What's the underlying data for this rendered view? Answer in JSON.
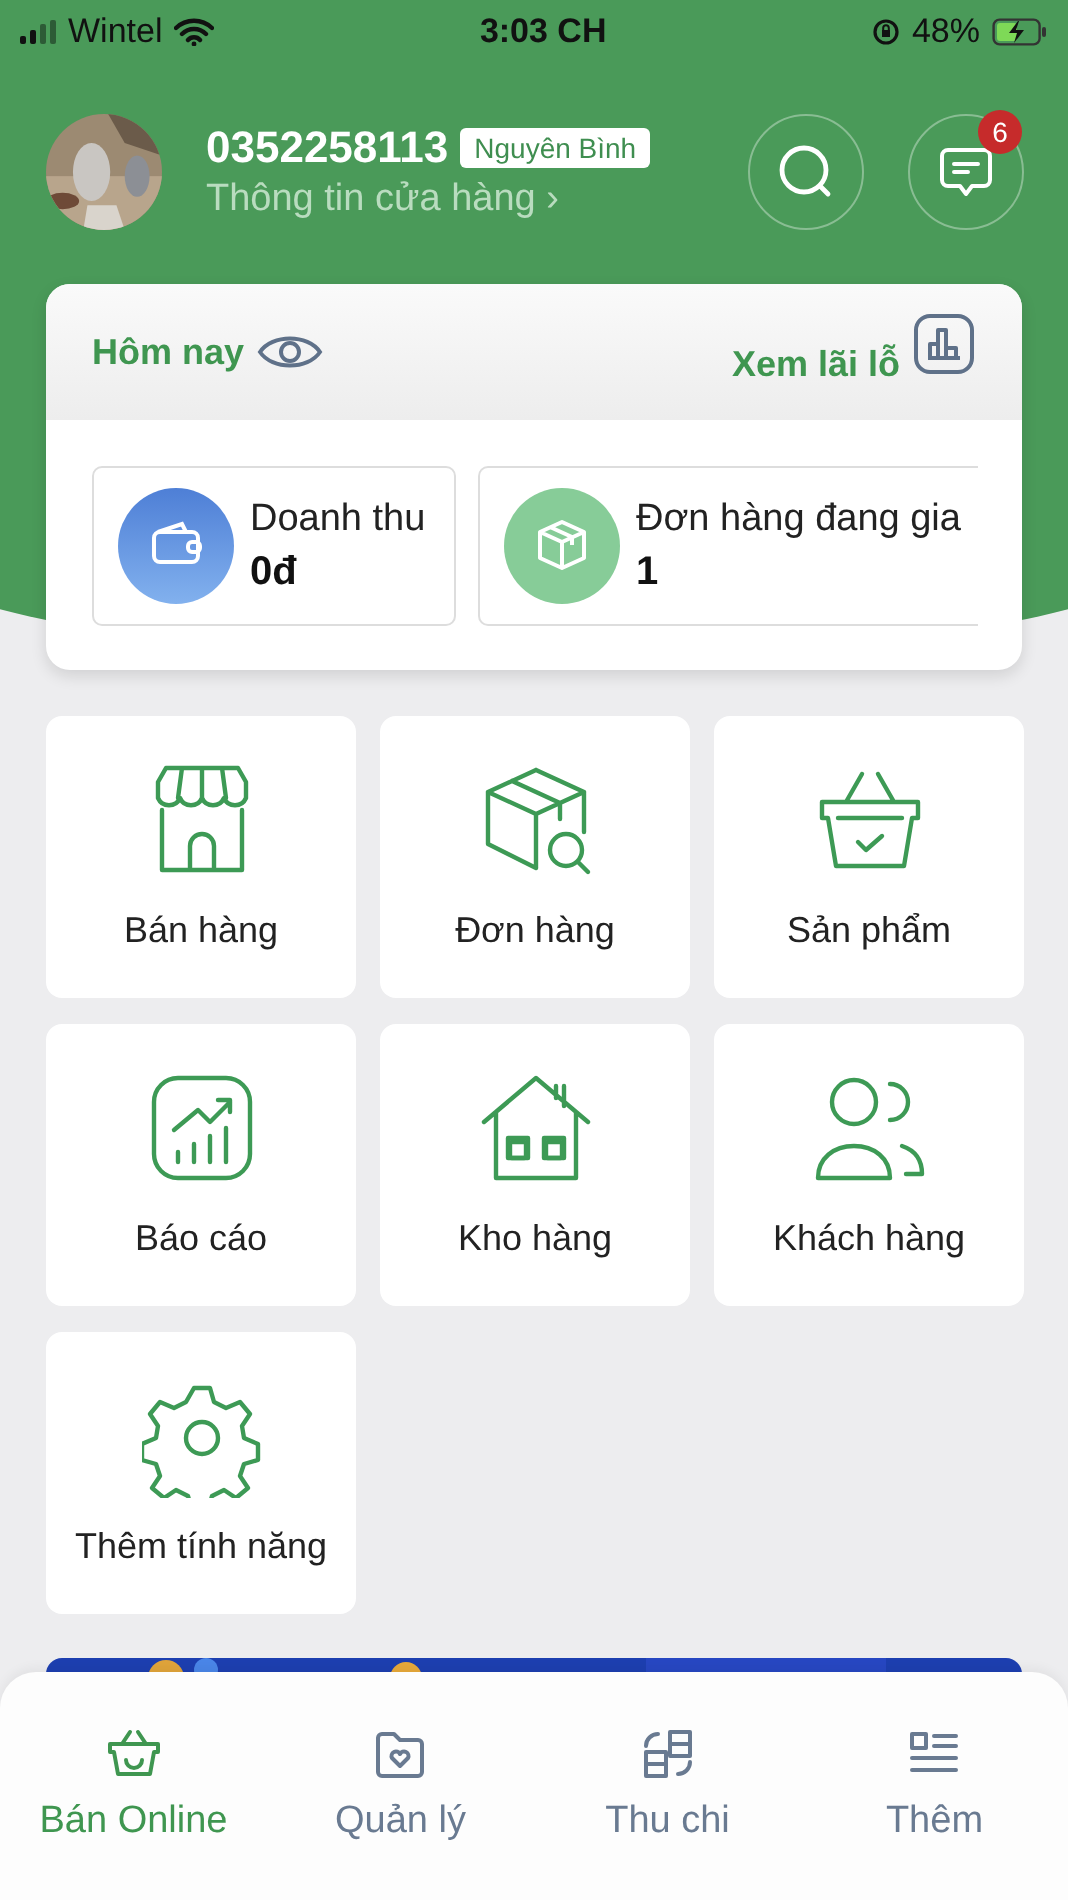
{
  "status_bar": {
    "carrier": "Wintel",
    "time": "3:03 CH",
    "battery": "48%"
  },
  "profile": {
    "kind": "picture",
    "phone": "0352258113",
    "name_badge": "Nguyên Bình",
    "store_link": "Thông tin cửa hàng",
    "store_chevron": "›",
    "notifications": "6"
  },
  "summary": {
    "title": "Hôm nay",
    "profit_link": "Xem lãi lỗ",
    "stats": [
      {
        "kind": "wallet",
        "label": "Doanh thu",
        "value": "0đ"
      },
      {
        "kind": "box",
        "label": "Đơn hàng đang gia",
        "value": "1"
      }
    ]
  },
  "features": [
    {
      "kind": "store",
      "label": "Bán hàng"
    },
    {
      "kind": "order",
      "label": "Đơn hàng"
    },
    {
      "kind": "basket",
      "label": "Sản phẩm"
    },
    {
      "kind": "report",
      "label": "Báo cáo"
    },
    {
      "kind": "warehouse",
      "label": "Kho hàng"
    },
    {
      "kind": "customers",
      "label": "Khách hàng"
    },
    {
      "kind": "gear",
      "label": "Thêm tính năng"
    }
  ],
  "bottom_nav": [
    {
      "kind": "basket",
      "label": "Bán Online",
      "selected": true
    },
    {
      "kind": "folder",
      "label": "Quản lý",
      "selected": false
    },
    {
      "kind": "exchange",
      "label": "Thu chi",
      "selected": false
    },
    {
      "kind": "list",
      "label": "Thêm",
      "selected": false
    }
  ]
}
